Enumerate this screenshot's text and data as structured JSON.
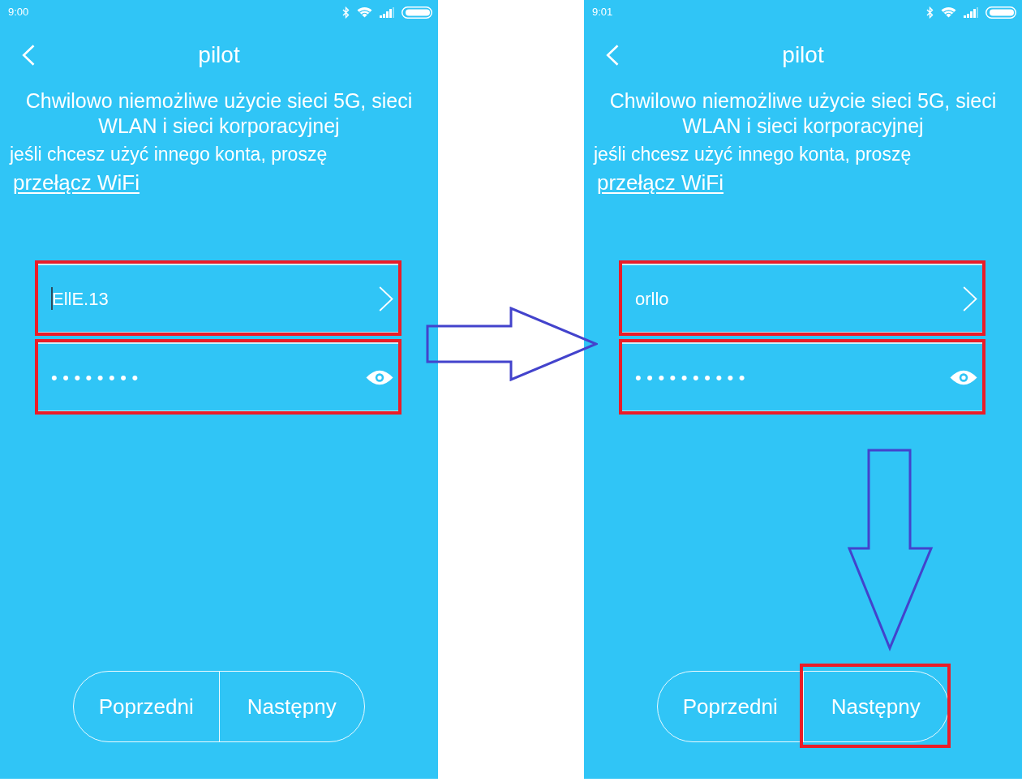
{
  "screens": [
    {
      "status_bar": {
        "time": "9:00"
      },
      "title": "pilot",
      "notice": "Chwilowo niemożliwe użycie sieci 5G, sieci WLAN i sieci korporacyjnej",
      "hint": "jeśli chcesz użyć innego konta, proszę",
      "link": "przełącz WiFi",
      "network_field": {
        "value": "EllE.13",
        "focused": true,
        "highlighted": true
      },
      "password_field": {
        "value": "••••••••",
        "highlighted": true
      },
      "buttons": [
        {
          "label": "Poprzedni",
          "highlighted": false
        },
        {
          "label": "Następny",
          "highlighted": false
        }
      ]
    },
    {
      "status_bar": {
        "time": "9:01"
      },
      "title": "pilot",
      "notice": "Chwilowo niemożliwe użycie sieci 5G, sieci WLAN i sieci korporacyjnej",
      "hint": "jeśli chcesz użyć innego konta, proszę",
      "link": "przełącz WiFi",
      "network_field": {
        "value": "orllo",
        "highlighted": true
      },
      "password_field": {
        "value": "••••••••••",
        "highlighted": true
      },
      "buttons": [
        {
          "label": "Poprzedni",
          "highlighted": false
        },
        {
          "label": "Następny",
          "highlighted": true
        }
      ],
      "down_arrow": true
    }
  ],
  "transition_arrow": true
}
